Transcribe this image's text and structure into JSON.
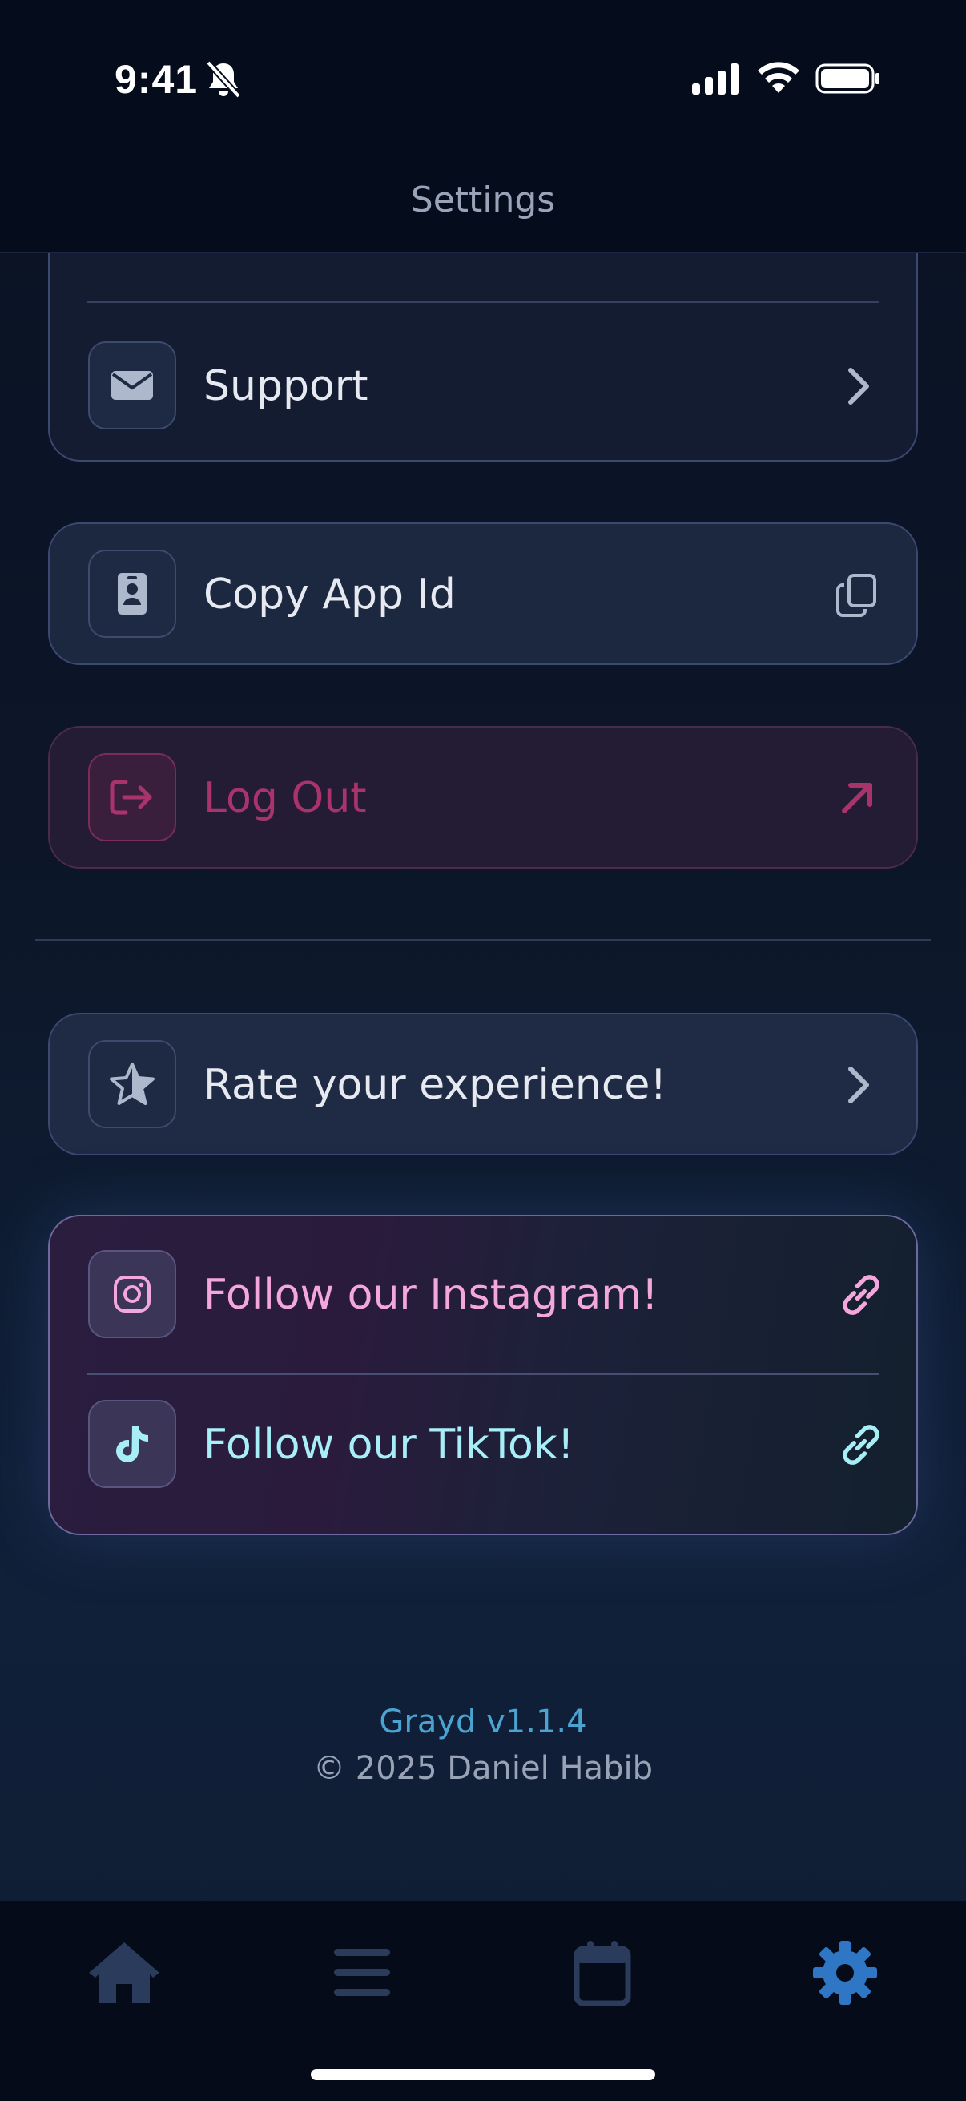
{
  "status_bar": {
    "time": "9:41"
  },
  "header": {
    "title": "Settings"
  },
  "settings": {
    "support_label": "Support",
    "copy_app_id_label": "Copy App Id",
    "logout_label": "Log Out",
    "rate_label": "Rate your experience!",
    "instagram_label": "Follow our Instagram!",
    "tiktok_label": "Follow our TikTok!"
  },
  "footer": {
    "version": "Grayd v1.1.4",
    "copyright": "© 2025 Daniel Habib"
  },
  "tab_bar": {
    "items": [
      "home-icon",
      "list-icon",
      "calendar-icon",
      "gear-icon"
    ],
    "active": "gear-icon"
  },
  "colors": {
    "accent": "#2f76c4",
    "danger": "#a9336b",
    "instagram": "#f4a7dc",
    "tiktok": "#a7eef7",
    "version": "#4aa3d1"
  }
}
